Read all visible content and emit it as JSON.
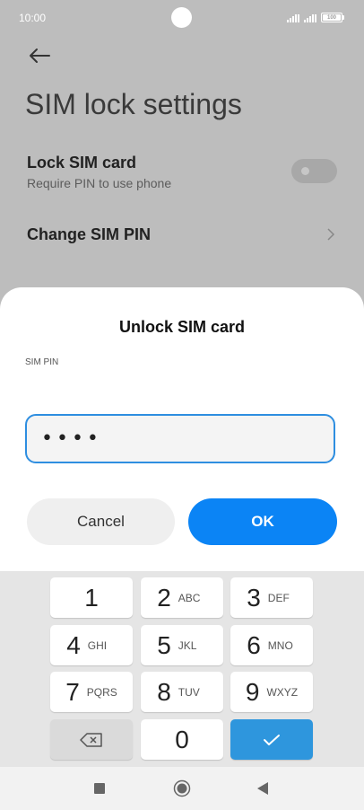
{
  "status_bar": {
    "time": "10:00",
    "battery": "100"
  },
  "header": {
    "title": "SIM lock settings"
  },
  "settings": {
    "lock_sim": {
      "title": "Lock SIM card",
      "subtitle": "Require PIN to use phone",
      "enabled": false
    },
    "change_pin": {
      "title": "Change SIM PIN"
    }
  },
  "dialog": {
    "title": "Unlock SIM card",
    "field_label": "SIM PIN",
    "pin_value": "••••",
    "cancel_label": "Cancel",
    "ok_label": "OK"
  },
  "keypad": {
    "keys": [
      {
        "num": "1",
        "letters": ""
      },
      {
        "num": "2",
        "letters": "ABC"
      },
      {
        "num": "3",
        "letters": "DEF"
      },
      {
        "num": "4",
        "letters": "GHI"
      },
      {
        "num": "5",
        "letters": "JKL"
      },
      {
        "num": "6",
        "letters": "MNO"
      },
      {
        "num": "7",
        "letters": "PQRS"
      },
      {
        "num": "8",
        "letters": "TUV"
      },
      {
        "num": "9",
        "letters": "WXYZ"
      },
      {
        "num": "0",
        "letters": ""
      }
    ]
  },
  "colors": {
    "accent": "#0b84f5",
    "focus_border": "#2e8ee0",
    "done_key": "#2e96dd"
  }
}
